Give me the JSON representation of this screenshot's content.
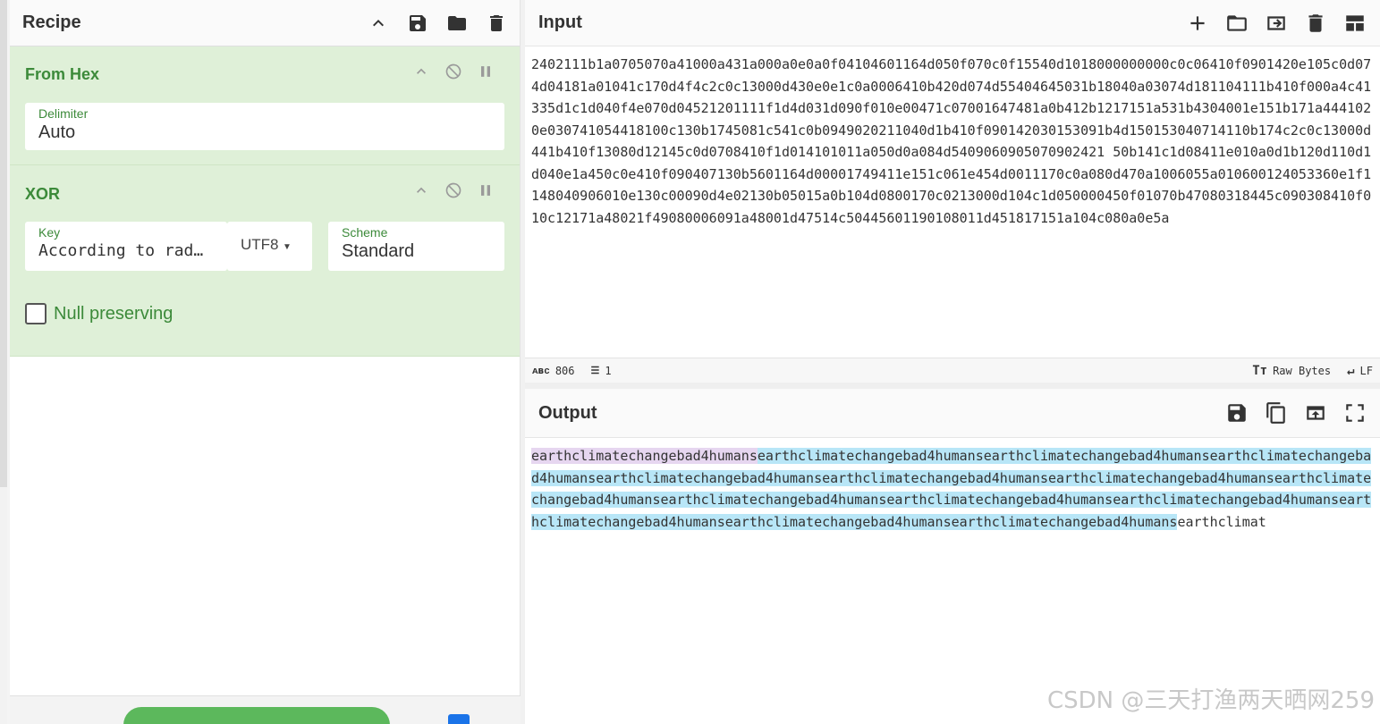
{
  "recipe": {
    "title": "Recipe",
    "operations": [
      {
        "name": "From Hex",
        "delimiter_label": "Delimiter",
        "delimiter_value": "Auto"
      },
      {
        "name": "XOR",
        "key_label": "Key",
        "key_value": "According to rad…",
        "key_encoding": "UTF8",
        "scheme_label": "Scheme",
        "scheme_value": "Standard",
        "null_preserving_label": "Null preserving",
        "null_preserving_checked": false
      }
    ]
  },
  "input": {
    "title": "Input",
    "text": "2402111b1a0705070a41000a431a000a0e0a0f04104601164d050f070c0f15540d1018000000000c0c06410f0901420e105c0d074d04181a01041c170d4f4c2c0c13000d430e0e1c0a0006410b420d074d55404645031b18040a03074d181104111b410f000a4c41335d1c1d040f4e070d04521201111f1d4d031d090f010e00471c07001647481a0b412b1217151a531b4304001e151b171a4441020e030741054418100c130b1745081c541c0b0949020211040d1b410f090142030153091b4d150153040714110b174c2c0c13000d441b410f13080d12145c0d0708410f1d014101011a050d0a084d5409060905070902421 50b141c1d08411e010a0d1b120d110d1d040e1a450c0e410f090407130b5601164d00001749411e151c061e454d0011170c0a080d470a1006055a010600124053360e1f1148040906010e130c00090d4e02130b05015a0b104d0800170c0213000d104c1d050000450f01070b47080318445c090308410f010c12171a48021f49080006091a48001d47514c50445601190108011d451817151a104c080a0e5a",
    "status": {
      "length": "806",
      "lines": "1",
      "encoding": "Raw Bytes",
      "eol": "LF"
    }
  },
  "output": {
    "title": "Output",
    "highlight_first": "earthclimatechangebad4humans",
    "highlight_rest": "earthclimatechangebad4humansearthclimatechangebad4humansearthclimatechangebad4humansearthclimatechangebad4humansearthclimatechangebad4humansearthclimatechangebad4humansearthclimatechangebad4humansearthclimatechangebad4humansearthclimatechangebad4humansearthclimatechangebad4humansearthclimatechangebad4humansearthclimatechangebad4humansearthclimatechangebad4humans",
    "tail": "earthclimat"
  },
  "watermark": "CSDN @三天打渔两天晒网259"
}
